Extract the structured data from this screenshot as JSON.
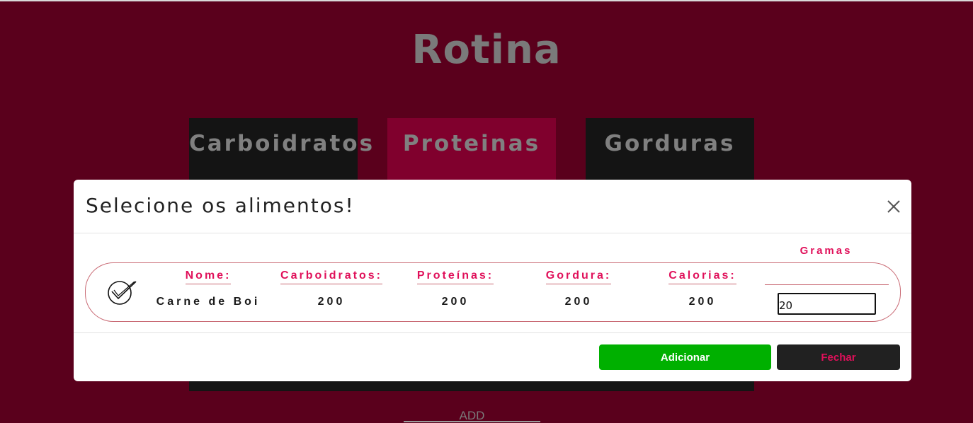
{
  "page": {
    "title": "Rotina",
    "tabs": [
      {
        "label": "Carboidratos",
        "active": false
      },
      {
        "label": "Proteinas",
        "active": true
      },
      {
        "label": "Gorduras",
        "active": false
      }
    ],
    "add_label": "ADD"
  },
  "modal": {
    "title": "Selecione os alimentos!",
    "gramas_label": "Gramas",
    "columns": {
      "nome": "Nome:",
      "carboidratos": "Carboidratos:",
      "proteinas": "Proteínas:",
      "gordura": "Gordura:",
      "calorias": "Calorias:"
    },
    "item": {
      "nome": "Carne de Boi",
      "carboidratos": "200",
      "proteinas": "200",
      "gordura": "200",
      "calorias": "200",
      "gramas": "20"
    },
    "buttons": {
      "add": "Adicionar",
      "close": "Fechar"
    }
  },
  "colors": {
    "background": "#5a001c",
    "active_tab": "#80002d",
    "accent": "#e0105a",
    "add_button": "#00b000"
  },
  "icons": {
    "close": "close-icon",
    "check": "check-icon"
  }
}
